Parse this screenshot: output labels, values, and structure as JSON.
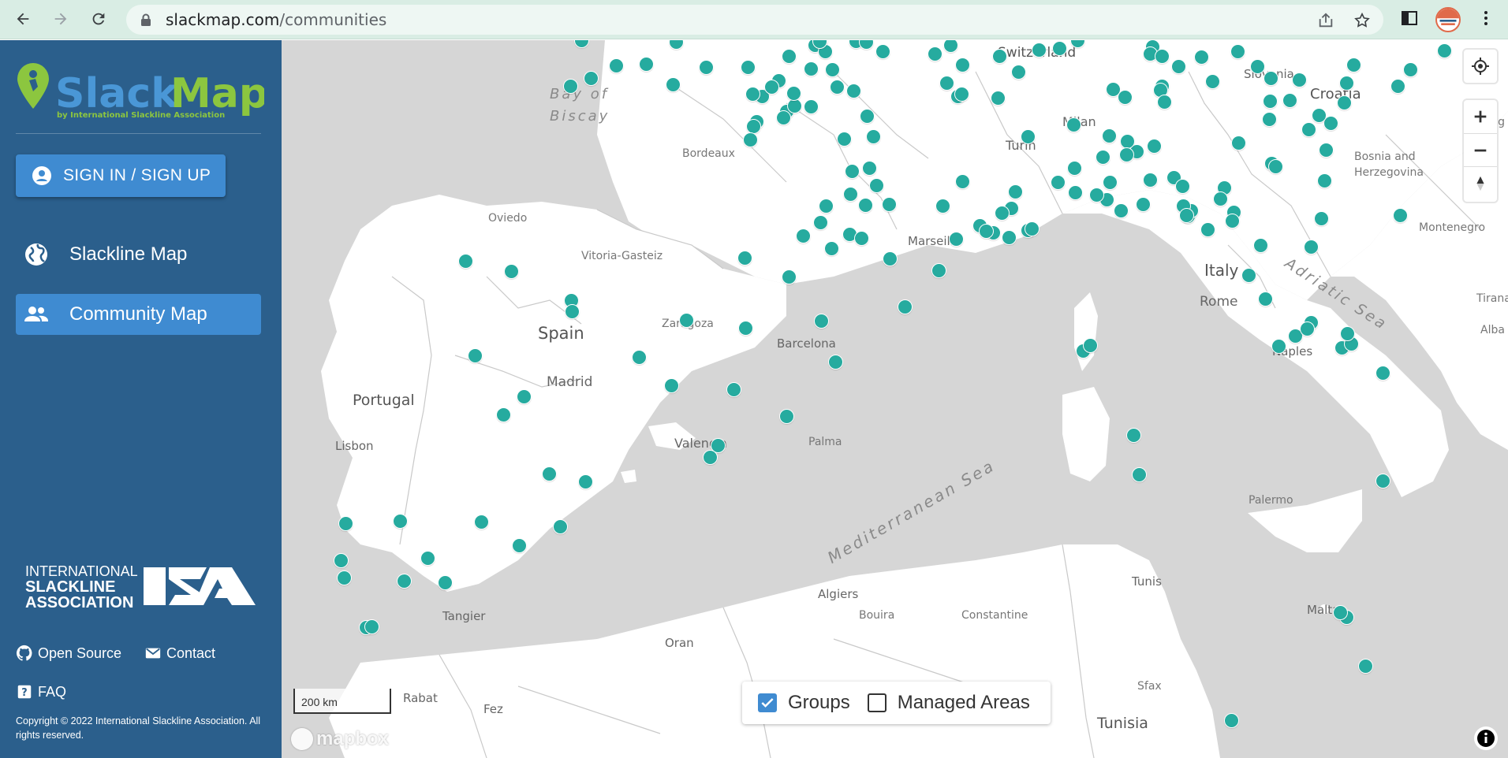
{
  "browser": {
    "url_host": "slackmap.com",
    "url_path": "/communities"
  },
  "sidebar": {
    "logo_text": "SlackMap",
    "logo_subtitle": "by International Slackline Association",
    "signin_label": "SIGN IN / SIGN UP",
    "nav": [
      {
        "label": "Slackline Map",
        "icon": "globe-icon",
        "active": false
      },
      {
        "label": "Community Map",
        "icon": "people-icon",
        "active": true
      }
    ],
    "isa_logo_lines": [
      "INTERNATIONAL",
      "SLACKLINE",
      "ASSOCIATION"
    ],
    "isa_logo_mark": "ISA",
    "footer": {
      "open_source": "Open Source",
      "contact": "Contact",
      "faq": "FAQ",
      "copyright": "Copyright © 2022 International Slackline Association. All rights reserved."
    }
  },
  "map": {
    "labels": [
      {
        "text": "Bay of",
        "kind": "sea-small"
      },
      {
        "text": "Biscay",
        "kind": "sea-small"
      },
      {
        "text": "Bordeaux",
        "kind": "city"
      },
      {
        "text": "Oviedo",
        "kind": "city"
      },
      {
        "text": "Vitoria-Gasteiz",
        "kind": "city"
      },
      {
        "text": "Spain",
        "kind": "country"
      },
      {
        "text": "Zaragoza",
        "kind": "city"
      },
      {
        "text": "Barcelona",
        "kind": "city"
      },
      {
        "text": "Madrid",
        "kind": "country"
      },
      {
        "text": "Portugal",
        "kind": "country"
      },
      {
        "text": "Lisbon",
        "kind": "city"
      },
      {
        "text": "Valencia",
        "kind": "city"
      },
      {
        "text": "Palma",
        "kind": "city"
      },
      {
        "text": "Tangier",
        "kind": "city"
      },
      {
        "text": "Oran",
        "kind": "city"
      },
      {
        "text": "Algiers",
        "kind": "city"
      },
      {
        "text": "Bouira",
        "kind": "small"
      },
      {
        "text": "Constantine",
        "kind": "small"
      },
      {
        "text": "Tunis",
        "kind": "city"
      },
      {
        "text": "Sfax",
        "kind": "small"
      },
      {
        "text": "Tunisia",
        "kind": "country"
      },
      {
        "text": "Rabat",
        "kind": "city"
      },
      {
        "text": "Fez",
        "kind": "city"
      },
      {
        "text": "Marseille",
        "kind": "city"
      },
      {
        "text": "Turin",
        "kind": "city"
      },
      {
        "text": "Milan",
        "kind": "city"
      },
      {
        "text": "Switzerland",
        "kind": "country"
      },
      {
        "text": "Slovenia",
        "kind": "city"
      },
      {
        "text": "Croatia",
        "kind": "country"
      },
      {
        "text": "Bosnia and",
        "kind": "city"
      },
      {
        "text": "Herzegovina",
        "kind": "city"
      },
      {
        "text": "Montenegro",
        "kind": "city"
      },
      {
        "text": "Belg",
        "kind": "city"
      },
      {
        "text": "Italy",
        "kind": "country"
      },
      {
        "text": "Rome",
        "kind": "country"
      },
      {
        "text": "Naples",
        "kind": "city"
      },
      {
        "text": "Palermo",
        "kind": "small"
      },
      {
        "text": "Malta",
        "kind": "city"
      },
      {
        "text": "Tirana",
        "kind": "city"
      },
      {
        "text": "Alba",
        "kind": "city"
      },
      {
        "text": "Adriatic Sea",
        "kind": "sea"
      },
      {
        "text": "Mediterranean Sea",
        "kind": "sea"
      }
    ],
    "marker_count_visible": 170,
    "scale_label": "200 km",
    "attribution_logo": "mapbox",
    "layers": [
      {
        "label": "Groups",
        "checked": true
      },
      {
        "label": "Managed Areas",
        "checked": false
      }
    ],
    "colors": {
      "marker": "#26ab9f",
      "land": "#ffffff",
      "sea": "#d6d6d6",
      "sidebar": "#2b5f8c",
      "accent": "#3f8bd1"
    }
  }
}
